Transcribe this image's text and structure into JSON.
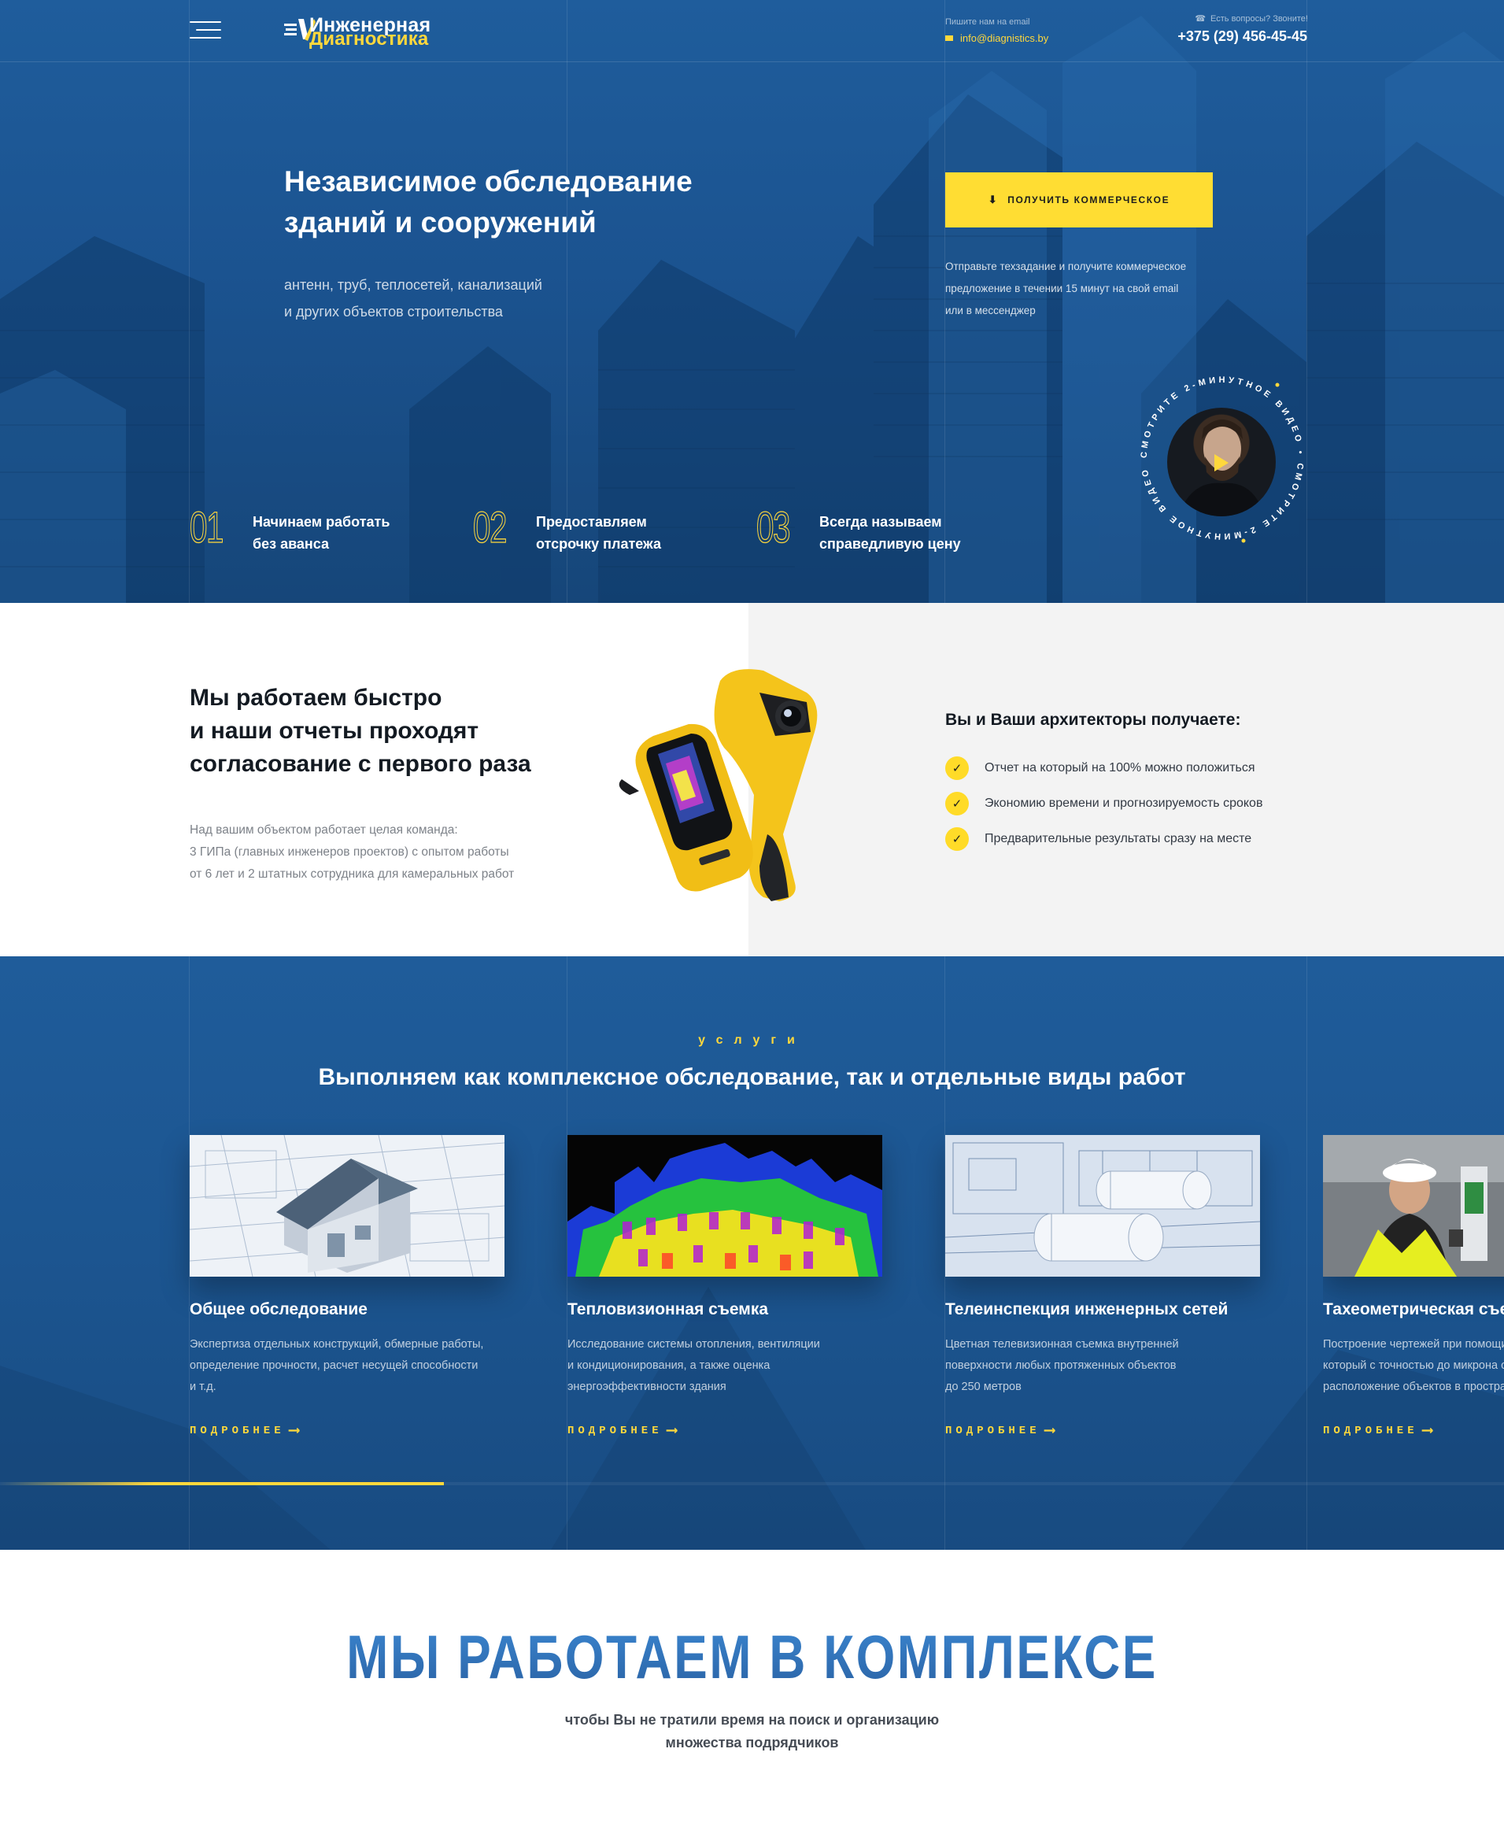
{
  "header": {
    "logo_line1": "Инженерная",
    "logo_line2": "Диагностика",
    "email_caption": "Пишите нам на email",
    "email": "info@diagnistics.by",
    "phone_caption": "Есть вопросы? Звоните!",
    "phone": "+375 (29) 456-45-45"
  },
  "hero": {
    "title_line1": "Независимое обследование",
    "title_line2": "зданий и сооружений",
    "subtitle_line1": "антенн, труб, теплосетей, канализаций",
    "subtitle_line2": "и других объектов строительства",
    "cta_label": "получить коммерческое",
    "cta_text_line1": "Отправьте техзадание и получите коммерческое",
    "cta_text_line2": "предложение в течении 15 минут на свой email",
    "cta_text_line3": "или в мессенджер",
    "video_circle_text": "СМОТРИТЕ 2-МИНУТНОЕ ВИДЕО • СМОТРИТЕ 2-МИНУТНОЕ ВИДЕО •",
    "features": [
      {
        "num": "01",
        "line1": "Начинаем работать",
        "line2": "без аванса"
      },
      {
        "num": "02",
        "line1": "Предоставляем",
        "line2": "отсрочку платежа"
      },
      {
        "num": "03",
        "line1": "Всегда называем",
        "line2": "справедливую цену"
      }
    ]
  },
  "about": {
    "title_line1": "Мы работаем быстро",
    "title_line2": "и наши отчеты проходят",
    "title_line3": "согласование с первого раза",
    "text_line1": "Над вашим объектом работает целая команда:",
    "text_line2": "3 ГИПа (главных инженеров проектов) с опытом работы",
    "text_line3": "от 6 лет и 2 штатных сотрудника для камеральных работ",
    "benefits_title": "Вы и Ваши архитекторы получаете:",
    "benefits": [
      "Отчет на который на 100% можно положиться",
      "Экономию времени и прогнозируемость сроков",
      "Предварительные результаты сразу на месте"
    ]
  },
  "services": {
    "label": "услуги",
    "title": "Выполняем как комплексное обследование, так и отдельные виды работ",
    "more_label": "подробнее",
    "carousel_progress_percent": 29.5,
    "cards": [
      {
        "title": "Общее обследование",
        "line1": "Экспертиза отдельных конструкций, обмерные работы,",
        "line2": "определение прочности, расчет несущей способности",
        "line3": "и т.д."
      },
      {
        "title": "Тепловизионная съемка",
        "line1": "Исследование системы отопления, вентиляции",
        "line2": "и кондиционирования, а также оценка",
        "line3": "энергоэффективности здания"
      },
      {
        "title": "Телеинспекция инженерных сетей",
        "line1": "Цветная телевизионная съемка внутренней",
        "line2": "поверхности любых протяженных объектов",
        "line3": "до 250 метров"
      },
      {
        "title": "Тахеометрическая съемка",
        "line1": "Построение чертежей при помощи тахеометра,",
        "line2": "который с точностью до микрона определяет",
        "line3": "расположение объектов в пространстве"
      }
    ]
  },
  "complex": {
    "title": "МЫ РАБОТАЕМ В КОМПЛЕКСЕ",
    "sub_line1": "чтобы Вы не тратили время на поиск и организацию",
    "sub_line2": "множества подрядчиков"
  },
  "colors": {
    "accent": "#ffd83c",
    "hero_blue": "#1c5592",
    "text_dark": "#131a22"
  }
}
